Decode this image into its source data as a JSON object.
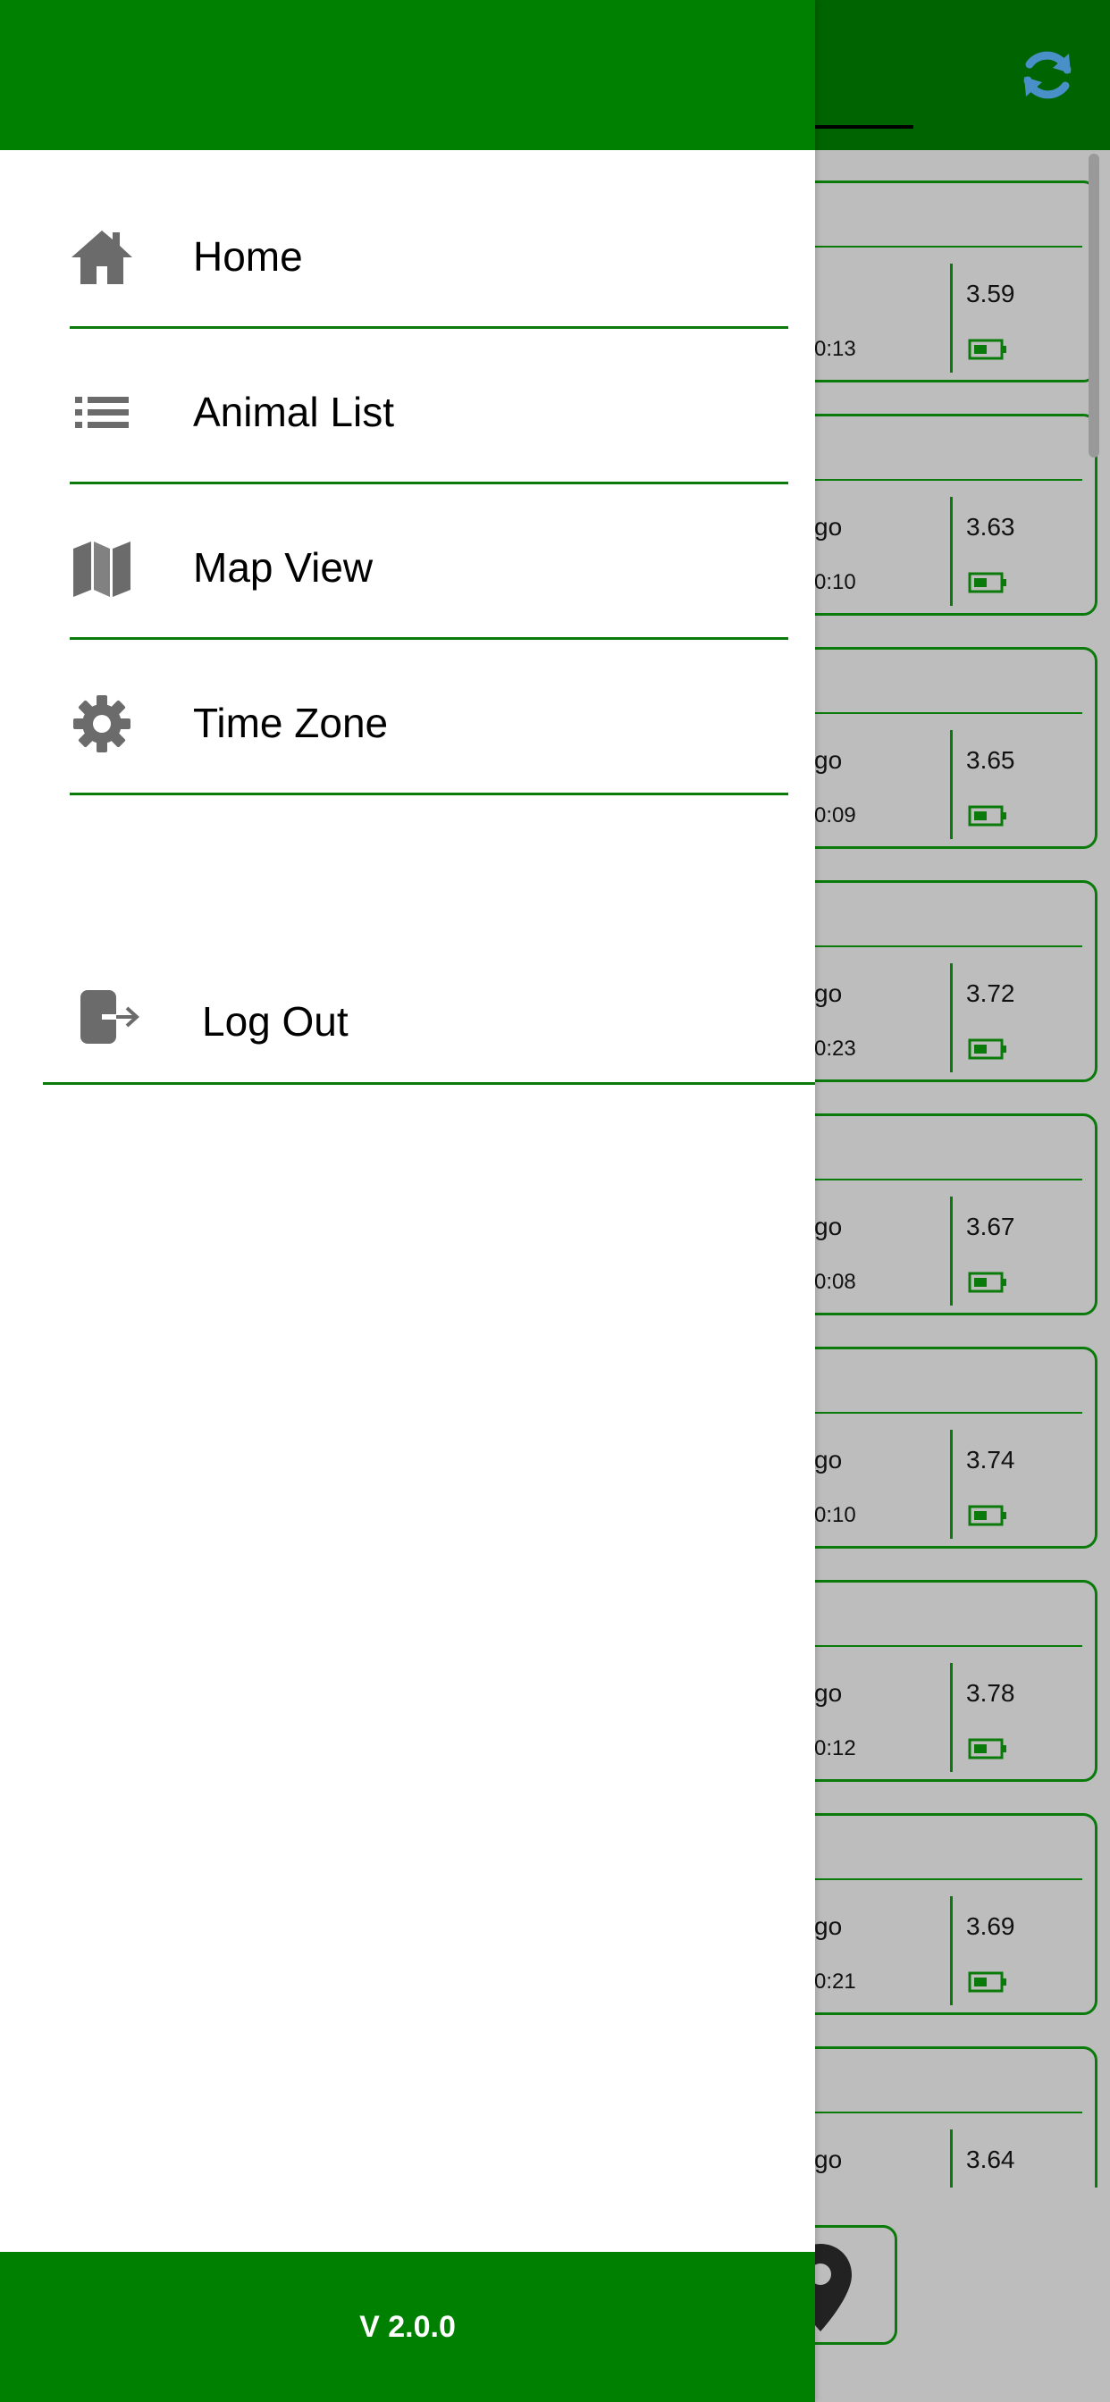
{
  "colors": {
    "brand_green": "#008000",
    "line_green": "#0a7a0a",
    "icon_gray": "#6b6b6b"
  },
  "background_list": {
    "refresh_icon": "refresh-icon",
    "cards": [
      {
        "ago": "",
        "time": "0:13",
        "value": "3.59"
      },
      {
        "ago": "go",
        "time": "0:10",
        "value": "3.63"
      },
      {
        "ago": "go",
        "time": "0:09",
        "value": "3.65"
      },
      {
        "ago": "go",
        "time": "0:23",
        "value": "3.72"
      },
      {
        "ago": "go",
        "time": "0:08",
        "value": "3.67"
      },
      {
        "ago": "go",
        "time": "0:10",
        "value": "3.74"
      },
      {
        "ago": "go",
        "time": "0:12",
        "value": "3.78"
      },
      {
        "ago": "go",
        "time": "0:21",
        "value": "3.69"
      },
      {
        "ago": "go",
        "time": "",
        "value": "3.64"
      }
    ]
  },
  "drawer": {
    "menu": [
      {
        "label": "Home",
        "icon": "home-icon"
      },
      {
        "label": "Animal List",
        "icon": "list-icon"
      },
      {
        "label": "Map View",
        "icon": "map-icon"
      },
      {
        "label": "Time Zone",
        "icon": "gear-icon"
      }
    ],
    "logout": {
      "label": "Log Out",
      "icon": "logout-icon"
    },
    "version": "V 2.0.0"
  }
}
